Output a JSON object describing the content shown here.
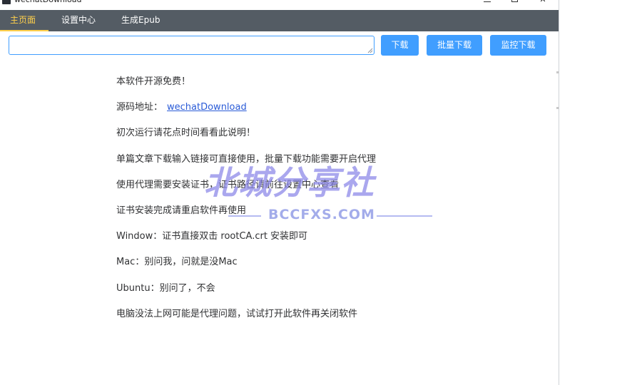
{
  "window": {
    "title": "wechatDownload",
    "controls": {
      "minimize_icon": "minimize-icon",
      "maximize_icon": "maximize-icon",
      "close_glyph": "✕"
    }
  },
  "menu": {
    "items": [
      {
        "label": "主页面",
        "active": true
      },
      {
        "label": "设置中心",
        "active": false
      },
      {
        "label": "生成Epub",
        "active": false
      }
    ],
    "colors": {
      "background": "#545c64",
      "text": "#ffffff",
      "active": "#ffd04b"
    }
  },
  "toolbar": {
    "url_input": {
      "value": "",
      "placeholder": ""
    },
    "download_label": "下载",
    "batch_label": "批量下载",
    "monitor_label": "监控下载",
    "button_color": "#409eff"
  },
  "info": {
    "line1": "本软件开源免费！",
    "repo_prefix": "源码地址：",
    "repo_link": "wechatDownload",
    "line3": "初次运行请花点时间看看此说明！",
    "line4": "单篇文章下载输入链接可直接使用，批量下载功能需要开启代理",
    "line5": "使用代理需要安装证书，证书路径请前往设置中心查看",
    "line6": "证书安装完成请重启软件再使用",
    "line7": "Window：证书直接双击 rootCA.crt 安装即可",
    "line8": "Mac：别问我，问就是没Mac",
    "line9": "Ubuntu：别问了，不会",
    "line10": "电脑没法上网可能是代理问题，试试打开此软件再关闭软件"
  },
  "watermark": {
    "title": "北城分享社",
    "subtitle": "BCCFXS.COM"
  }
}
